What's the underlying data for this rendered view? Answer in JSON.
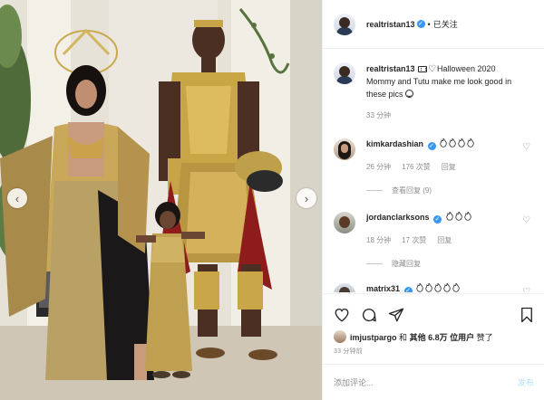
{
  "header": {
    "username": "realtristan13",
    "verified_mark": "✓",
    "separator": "•",
    "follow_label": "已关注"
  },
  "caption": {
    "username": "realtristan13",
    "text_after_icons": "Halloween 2020",
    "body": "Mommy and Tutu make me look good in these pics",
    "time": "33 分钟"
  },
  "comments": [
    {
      "username": "kimkardashian",
      "icons": [
        "fire-emoji",
        "fire-emoji",
        "fire-emoji",
        "fire-emoji"
      ],
      "time": "26 分钟",
      "likes": "176 次赞",
      "reply": "回复",
      "view_replies": "查看回复 (9)"
    },
    {
      "username": "jordanclarksons",
      "icons": [
        "fire-emoji",
        "fire-emoji",
        "fire-emoji"
      ],
      "time": "18 分钟",
      "likes": "17 次赞",
      "reply": "回复",
      "view_replies": "隐藏回复"
    },
    {
      "username": "matrix31",
      "icons": [
        "fire-emoji",
        "fire-emoji",
        "fire-emoji",
        "fire-emoji",
        "fire-emoji"
      ]
    }
  ],
  "likes": {
    "username": "imjustpargo",
    "conjunction": "和",
    "others": "其他 6.8万 位用户",
    "suffix": "赞了"
  },
  "timestamp": "33 分钟前",
  "comment_box": {
    "placeholder": "添加评论...",
    "post_label": "发布"
  },
  "colors": {
    "accent": "#3897f0",
    "muted_text": "#8e8e8e",
    "post_disabled": "#b2dffc",
    "border": "#efefef"
  }
}
